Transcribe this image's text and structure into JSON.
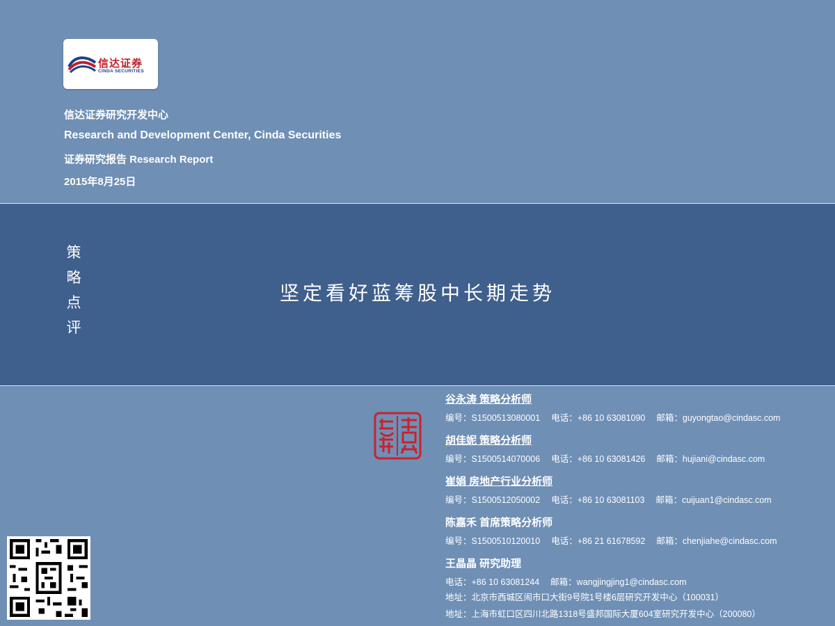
{
  "logo": {
    "name_cn": "信达证券",
    "name_en": "CINDA SECURITIES"
  },
  "header": {
    "line1": "信达证券研究开发中心",
    "line2": "Research and Development Center, Cinda Securities",
    "line3": "证券研究报告  Research Report",
    "date": "2015年8月25日"
  },
  "category": [
    "策",
    "略",
    "点",
    "评"
  ],
  "title": "坚定看好蓝筹股中长期走势",
  "seal_icon": "red-seal-stamp",
  "analysts": [
    {
      "name": "谷永涛 策略分析师",
      "id": "编号：S1500513080001",
      "phone": "电话：+86 10 63081090",
      "email": "邮箱：guyongtao@cindasc.com"
    },
    {
      "name": "胡佳妮 策略分析师",
      "id": "编号：S1500514070006",
      "phone": "电话：+86 10 63081426",
      "email": "邮箱：hujiani@cindasc.com"
    },
    {
      "name": "崔娟 房地产行业分析师",
      "id": "编号：S1500512050002",
      "phone": "电话：+86 10 63081103",
      "email": "邮箱：cuijuan1@cindasc.com"
    },
    {
      "name": "陈嘉禾 首席策略分析师",
      "id": "编号：S1500510120010",
      "phone": "电话：+86 21 61678592",
      "email": "邮箱：chenjiahe@cindasc.com"
    }
  ],
  "assistant": {
    "name": "王晶晶 研究助理",
    "phone": "电话：+86 10 63081244",
    "email": "邮箱：wangjingjing1@cindasc.com"
  },
  "addresses": [
    "地址：北京市西城区闹市口大街9号院1号楼6层研究开发中心（100031）",
    "地址：上海市虹口区四川北路1318号盛邦国际大厦604室研究开发中心（200080）"
  ],
  "colors": {
    "background": "#6f8fb5",
    "band": "#3f5f8c",
    "seal": "#c8222d",
    "logo_red": "#c01f2b",
    "logo_blue": "#1f3f8a"
  }
}
